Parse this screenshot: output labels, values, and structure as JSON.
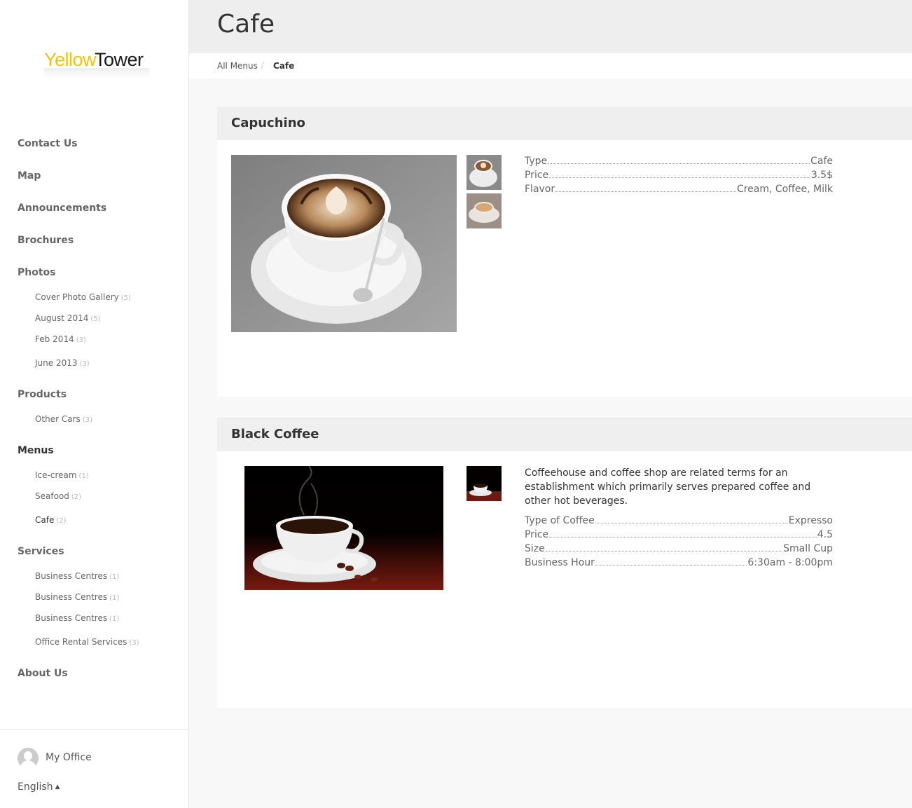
{
  "brand": {
    "logo_part1": "Yellow",
    "logo_part2": "Tower",
    "accent": "#f2c40f"
  },
  "sidebar": {
    "items": [
      {
        "label": "Contact Us"
      },
      {
        "label": "Map"
      },
      {
        "label": "Announcements"
      },
      {
        "label": "Brochures"
      },
      {
        "label": "Photos",
        "children": [
          {
            "label": "Cover Photo Gallery",
            "count": "(5)"
          },
          {
            "label": "August 2014",
            "count": "(5)"
          },
          {
            "label": "Feb 2014",
            "count": "(3)"
          },
          {
            "label": "June 2013",
            "count": "(3)"
          }
        ]
      },
      {
        "label": "Products",
        "children": [
          {
            "label": "Other Cars",
            "count": "(3)"
          }
        ]
      },
      {
        "label": "Menus",
        "children": [
          {
            "label": "Ice-cream",
            "count": "(1)"
          },
          {
            "label": "Seafood",
            "count": "(2)"
          },
          {
            "label": "Cafe",
            "count": "(2)"
          }
        ]
      },
      {
        "label": "Services",
        "children": [
          {
            "label": "Business Centres",
            "count": "(1)"
          },
          {
            "label": "Business Centres",
            "count": "(1)"
          },
          {
            "label": "Business Centres",
            "count": "(1)"
          },
          {
            "label": "Office Rental Services",
            "count": "(3)"
          }
        ]
      },
      {
        "label": "About Us"
      }
    ],
    "footer": {
      "office_label": "My Office",
      "language": "English",
      "language_caret": "▲"
    }
  },
  "header": {
    "title": "Cafe"
  },
  "breadcrumb": {
    "root": "All Menus",
    "separator": "/",
    "current": "Cafe"
  },
  "items": [
    {
      "title": "Capuchino",
      "specs": [
        {
          "key": "Type",
          "value": "Cafe"
        },
        {
          "key": "Price",
          "value": "3.5$"
        },
        {
          "key": "Flavor",
          "value": "Cream, Coffee, Milk"
        }
      ]
    },
    {
      "title": "Black Coffee",
      "description": "Coffeehouse and coffee shop are related terms for an establishment which primarily serves prepared coffee and other hot beverages.",
      "specs": [
        {
          "key": "Type of Coffee",
          "value": "Expresso"
        },
        {
          "key": "Price",
          "value": "4.5"
        },
        {
          "key": "Size",
          "value": "Small Cup"
        },
        {
          "key": "Business Hour",
          "value": "6:30am - 8:00pm"
        }
      ]
    }
  ]
}
